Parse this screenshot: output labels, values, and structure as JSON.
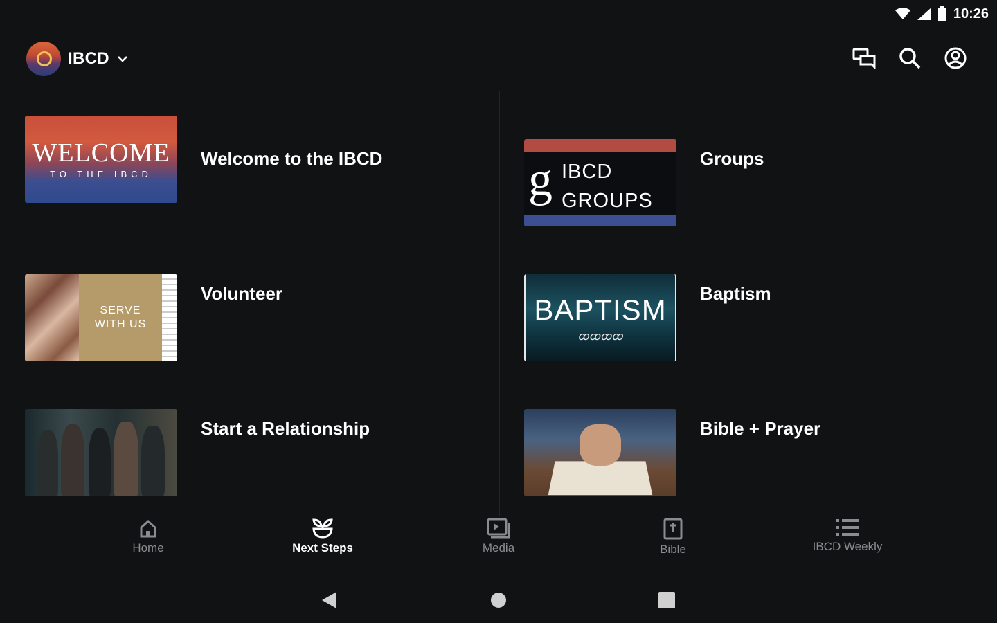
{
  "status_bar": {
    "time": "10:26"
  },
  "header": {
    "brand_name": "IBCD"
  },
  "cards": [
    {
      "label": "Welcome to the IBCD",
      "thumb_big": "WELCOME",
      "thumb_small": "TO THE IBCD"
    },
    {
      "label": "Groups",
      "thumb_line1": "IBCD",
      "thumb_line2": "GROUPS",
      "thumb_glyph": "g"
    },
    {
      "label": "Volunteer",
      "thumb_line1": "SERVE",
      "thumb_line2": "WITH US"
    },
    {
      "label": "Baptism",
      "thumb_text": "BAPTISM",
      "thumb_sub": "ꝏꝏꝏꝏ"
    },
    {
      "label": "Start a Relationship"
    },
    {
      "label": "Bible + Prayer"
    }
  ],
  "bottom_nav": [
    {
      "label": "Home",
      "icon": "home-icon"
    },
    {
      "label": "Next Steps",
      "icon": "sprout-icon",
      "active": true
    },
    {
      "label": "Media",
      "icon": "media-icon"
    },
    {
      "label": "Bible",
      "icon": "bible-icon"
    },
    {
      "label": "IBCD Weekly",
      "icon": "list-icon"
    }
  ],
  "colors": {
    "background": "#111214",
    "active_label": "#ffffff",
    "inactive_label": "#8a8c90"
  }
}
